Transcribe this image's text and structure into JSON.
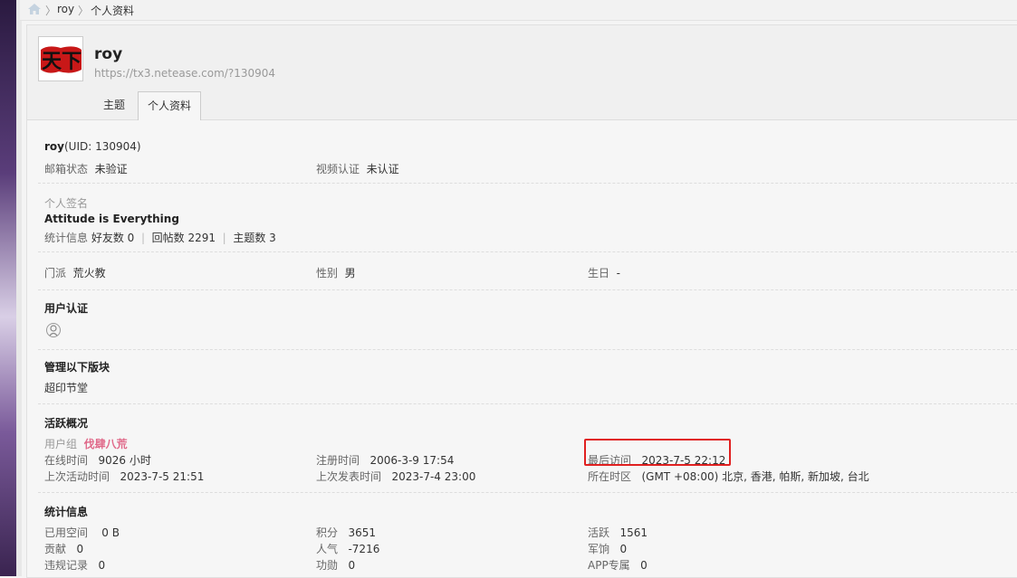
{
  "breadcrumb": {
    "home_icon": "home-icon",
    "items": [
      "roy",
      "个人资料"
    ],
    "separator": "〉"
  },
  "profile": {
    "name": "roy",
    "url": "https://tx3.netease.com/?130904",
    "tabs": [
      {
        "label": "主题",
        "active": false
      },
      {
        "label": "个人资料",
        "active": true
      }
    ]
  },
  "basic": {
    "name": "roy",
    "uid_text": "(UID: 130904)",
    "email_label": "邮箱状态",
    "email_value": "未验证",
    "video_label": "视频认证",
    "video_value": "未认证"
  },
  "signature": {
    "label": "个人签名",
    "text": "Attitude is Everything",
    "stats_label": "统计信息",
    "friends": "好友数 0",
    "replies": "回帖数 2291",
    "topics": "主题数 3"
  },
  "details": {
    "sect_label": "门派",
    "sect_value": "荒火教",
    "gender_label": "性别",
    "gender_value": "男",
    "birthday_label": "生日",
    "birthday_value": "-"
  },
  "auth": {
    "title": "用户认证",
    "icon": "certification-badge-icon"
  },
  "moderate": {
    "title": "管理以下版块",
    "board": "超印节堂"
  },
  "activity": {
    "title": "活跃概况",
    "group_label": "用户组",
    "group_value": "伐肆八荒",
    "online_label": "在线时间",
    "online_value": "9026 小时",
    "register_label": "注册时间",
    "register_value": "2006-3-9 17:54",
    "lastvisit_label": "最后访问",
    "lastvisit_value": "2023-7-5 22:12",
    "lastactive_label": "上次活动时间",
    "lastactive_value": "2023-7-5 21:51",
    "lastpost_label": "上次发表时间",
    "lastpost_value": "2023-7-4 23:00",
    "tz_label": "所在时区",
    "tz_value": "(GMT +08:00) 北京, 香港, 帕斯, 新加坡, 台北"
  },
  "stats": {
    "title": "统计信息",
    "space_label": "已用空间",
    "space_value": "0 B",
    "points_label": "积分",
    "points_value": "3651",
    "active_label": "活跃",
    "active_value": "1561",
    "contrib_label": "贡献",
    "contrib_value": "0",
    "pop_label": "人气",
    "pop_value": "-7216",
    "salary_label": "军饷",
    "salary_value": "0",
    "violation_label": "违规记录",
    "violation_value": "0",
    "merit_label": "功勋",
    "merit_value": "0",
    "app_label": "APP专属",
    "app_value": "0"
  },
  "colors": {
    "highlight": "#e02020",
    "group": "#e06a8a"
  }
}
